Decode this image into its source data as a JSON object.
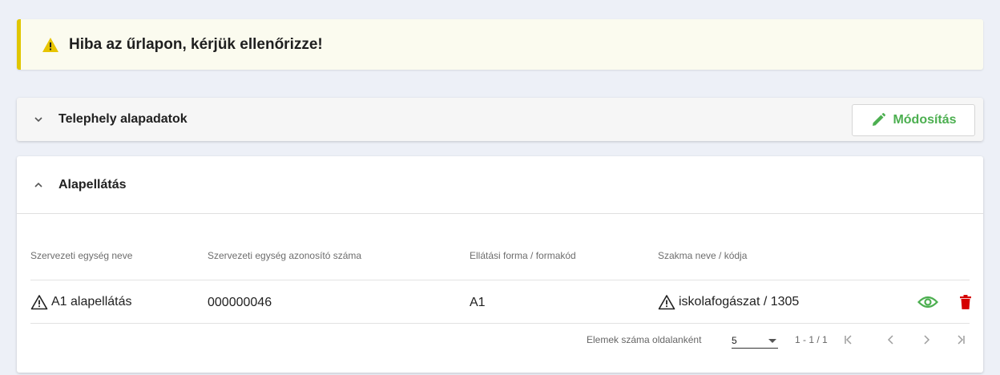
{
  "alert": {
    "message": "Hiba az űrlapon, kérjük ellenőrizze!",
    "icon": "warning-triangle-icon"
  },
  "panels": {
    "telephely": {
      "title": "Telephely alapadatok",
      "edit_label": "Módosítás"
    },
    "alapellatas": {
      "title": "Alapellátás",
      "columns": [
        "Szervezeti egység neve",
        "Szervezeti egység azonosító száma",
        "Ellátási forma / formakód",
        "Szakma neve / kódja"
      ],
      "rows": [
        {
          "name": "A1 alapellátás",
          "id": "000000046",
          "form": "A1",
          "profession": "iskolafogászat / 1305"
        }
      ],
      "pagination": {
        "per_page_label": "Elemek száma oldalanként",
        "per_page_value": "5",
        "range": "1 - 1 / 1"
      }
    }
  },
  "colors": {
    "accent_green": "#4caf50",
    "danger_red": "#d50000",
    "warning_yellow": "#e0c600"
  }
}
